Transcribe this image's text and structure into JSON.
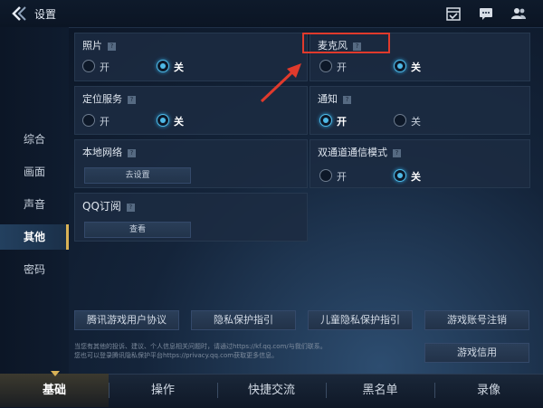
{
  "header": {
    "title": "设置"
  },
  "leftnav": {
    "items": [
      "综合",
      "画面",
      "声音",
      "其他",
      "密码"
    ],
    "active": "其他"
  },
  "panels": {
    "photos": {
      "label": "照片",
      "on": "开",
      "off": "关",
      "selected": "off"
    },
    "location": {
      "label": "定位服务",
      "on": "开",
      "off": "关",
      "selected": "off"
    },
    "local_network": {
      "label": "本地网络",
      "button": "去设置"
    },
    "qq_sub": {
      "label": "QQ订阅",
      "button": "查看"
    },
    "microphone": {
      "label": "麦克风",
      "on": "开",
      "off": "关",
      "selected": "off"
    },
    "notification": {
      "label": "通知",
      "on": "开",
      "off": "关",
      "selected": "on"
    },
    "dual_channel": {
      "label": "双通道通信模式",
      "on": "开",
      "off": "关",
      "selected": "off"
    }
  },
  "links": [
    "腾讯游戏用户协议",
    "隐私保护指引",
    "儿童隐私保护指引",
    "游戏账号注销"
  ],
  "credit": "游戏信用",
  "disclaimer": {
    "line1": "当您有其他的投诉、建议、个人信息相关问题时，请通过https://kf.qq.com/与我们联系。",
    "line2": "您也可以登录腾讯隐私保护平台https://privacy.qq.com获取更多信息。"
  },
  "bottom_tabs": [
    "基础",
    "操作",
    "快捷交流",
    "黑名单",
    "录像"
  ],
  "bottom_active": "基础",
  "colors": {
    "accent": "#4fb9e6",
    "highlight_box": "#e03a2c",
    "active_gold": "#d9b256"
  }
}
